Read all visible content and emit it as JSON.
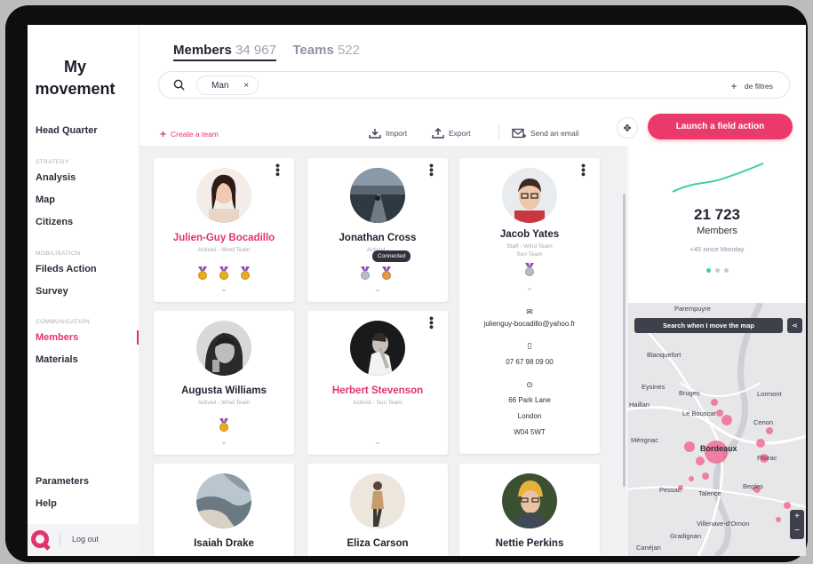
{
  "sidebar": {
    "title_line1": "My",
    "title_line2": "movement",
    "head_quarter": "Head Quarter",
    "section_strategy": "STRATEGY",
    "analysis": "Analysis",
    "map": "Map",
    "citizens": "Citizens",
    "section_mobilisation": "MOBILISATION",
    "fileds_action": "Fileds Action",
    "survey": "Survey",
    "section_communication": "COMMUNICATION",
    "members": "Members",
    "materials": "Materials",
    "parameters": "Parameters",
    "help": "Help",
    "logout": "Log out"
  },
  "header": {
    "tabs": [
      {
        "label": "Members",
        "count": "34 967"
      },
      {
        "label": "Teams",
        "count": "522"
      }
    ]
  },
  "search": {
    "chip": "Man",
    "chip_close": "×",
    "filters_label": "de filtres",
    "filters_plus": "+"
  },
  "toolbar": {
    "create_team": "Create a team",
    "create_plus": "+",
    "import": "Import",
    "export": "Export",
    "send_email": "Send an email",
    "launch": "Launch a field action",
    "expand_glyph": "✥"
  },
  "colors": {
    "accent": "#e2336b",
    "launch": "#ea3a6c",
    "trend": "#3ccf9e"
  },
  "cards": [
    {
      "name": "Julien-Guy Bocadillo",
      "role": "Activist - Wind Team"
    },
    {
      "name": "Jonathan Cross",
      "role": "Activist - ",
      "tooltip": "Connected"
    },
    {
      "name": "Jacob Yates",
      "role": "Staff - Wind Team",
      "team": "Sun Team"
    },
    {
      "name": "Augusta Williams",
      "role": "Activist - Wind Team"
    },
    {
      "name": "Herbert Stevenson",
      "role": "Activist - Sun Team"
    },
    {
      "name": "Isaiah Drake"
    },
    {
      "name": "Eliza Carson"
    },
    {
      "name": "Nettie Perkins"
    }
  ],
  "detail": {
    "email": "julienguy-bocadillo@yahoo.fr",
    "phone": "07 67 98 09 00",
    "address1": "66 Park Lane",
    "address2": "London",
    "postcode": "W04 5WT"
  },
  "stats": {
    "count": "21 723",
    "label": "Members",
    "since": "+45 since Monday"
  },
  "map": {
    "search_button": "Search when I move the map",
    "labels": {
      "parempuyre": "Parempuyre",
      "blanquefort": "Blanquefort",
      "eysines": "Eysines",
      "bruges": "Bruges",
      "lormont": "Lormont",
      "haillan": "Haillan",
      "bouscat": "Le Bouscat",
      "cenon": "Cenon",
      "merignac": "Mérignac",
      "bordeaux": "Bordeaux",
      "floirac": "Floirac",
      "begles": "Begles",
      "pessac": "Pessac",
      "talence": "Talence",
      "villenave": "Villenave-d'Ornon",
      "gradignan": "Gradignan",
      "canejan": "Canéjan"
    },
    "zoom_in": "+",
    "zoom_out": "−"
  }
}
